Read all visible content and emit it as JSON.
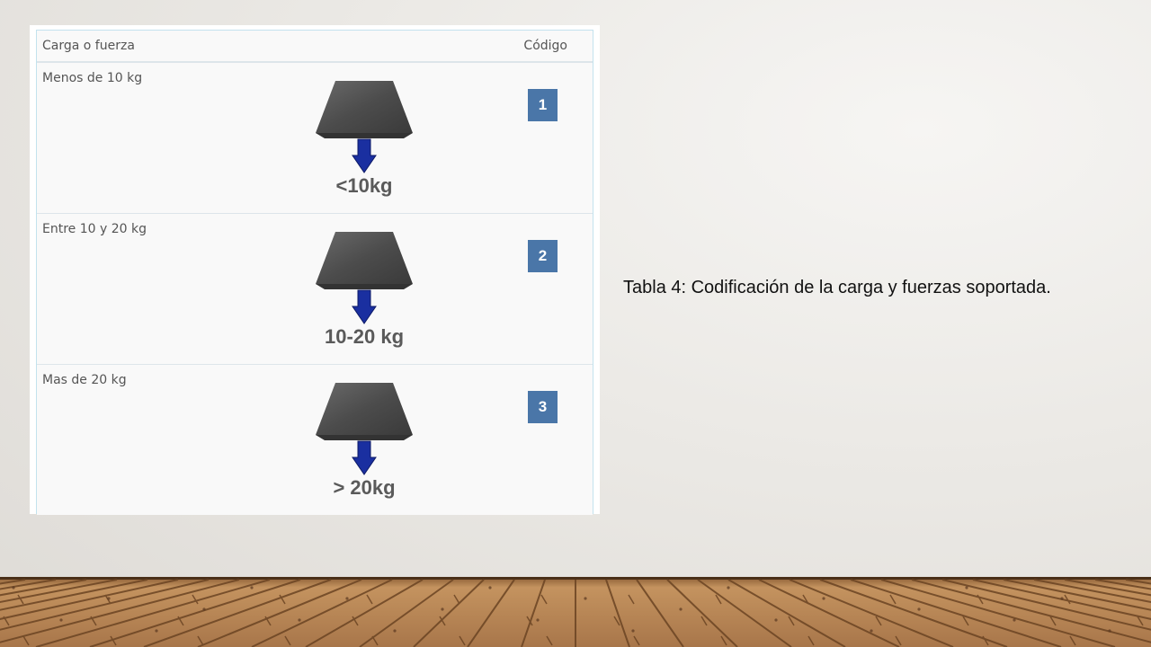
{
  "table": {
    "headers": {
      "load": "Carga o fuerza",
      "code": "Código"
    },
    "rows": [
      {
        "label": "Menos de 10 kg",
        "figure_label": "<10kg",
        "code": "1"
      },
      {
        "label": "Entre 10 y 20 kg",
        "figure_label": "10-20 kg",
        "code": "2"
      },
      {
        "label": "Mas de 20 kg",
        "figure_label": "> 20kg",
        "code": "3"
      }
    ]
  },
  "caption": "Tabla 4: Codificación de la carga y fuerzas soportada.",
  "icons": {
    "weight": "weight-block-icon",
    "arrow": "down-arrow-icon"
  },
  "colors": {
    "badge": "#4a76a8",
    "arrow": "#1a2fa0",
    "floor": "#b58556"
  }
}
